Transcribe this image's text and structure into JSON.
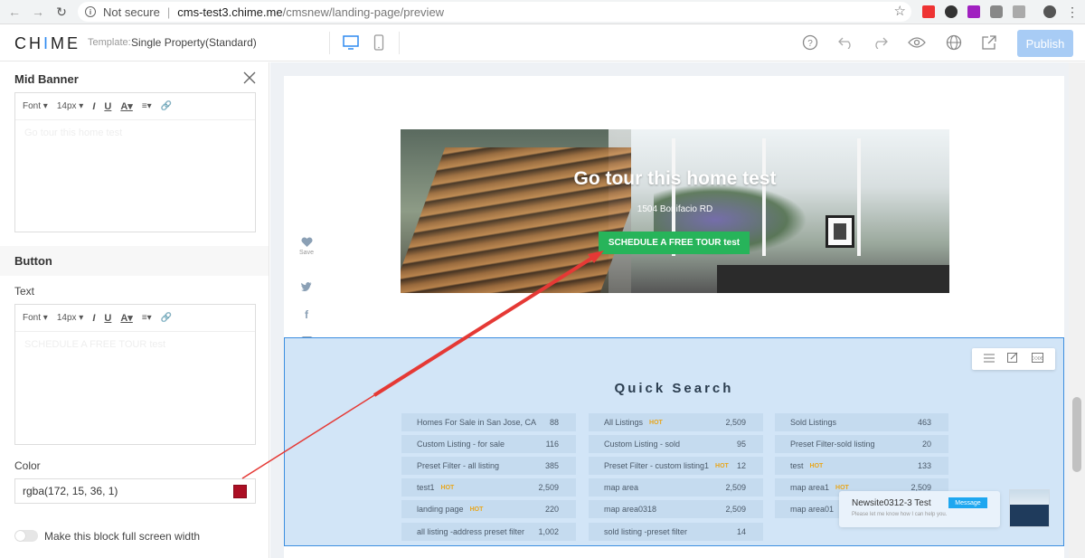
{
  "browser": {
    "not_secure": "Not secure",
    "host": "cms-test3.chime.me",
    "path": "/cmsnew/landing-page/preview"
  },
  "app": {
    "logo_prefix": "CH",
    "logo_i": "I",
    "logo_suffix": "ME",
    "template_label": "Template:",
    "template_name": "Single Property(Standard)",
    "publish_label": "Publish"
  },
  "panel": {
    "title": "Mid Banner",
    "editor1": {
      "font": "Font",
      "size": "14px",
      "placeholder": "Go tour this home test"
    },
    "button_section": "Button",
    "text_label": "Text",
    "editor2": {
      "font": "Font",
      "size": "14px",
      "placeholder": "SCHEDULE A FREE TOUR test"
    },
    "color_label": "Color",
    "color_value": "rgba(172, 15, 36, 1)",
    "color_hex": "#ac0f24",
    "fullscreen_label": "Make this block full screen width"
  },
  "banner": {
    "title": "Go tour this home test",
    "subtitle": "1504 Bonifacio RD",
    "cta": "SCHEDULE A FREE TOUR test"
  },
  "share": {
    "save_label": "Save"
  },
  "quick_search": {
    "title": "Quick Search",
    "hot_label": "HOT",
    "columns": [
      [
        {
          "name": "Homes For Sale in San Jose, CA",
          "count": "88",
          "hot": false
        },
        {
          "name": "Custom Listing - for sale",
          "count": "116",
          "hot": false
        },
        {
          "name": "Preset Filter - all listing",
          "count": "385",
          "hot": false
        },
        {
          "name": "test1",
          "count": "2,509",
          "hot": true
        },
        {
          "name": "landing page",
          "count": "220",
          "hot": true
        },
        {
          "name": "all listing -address preset filter",
          "count": "1,002",
          "hot": false
        }
      ],
      [
        {
          "name": "All Listings",
          "count": "2,509",
          "hot": true
        },
        {
          "name": "Custom Listing - sold",
          "count": "95",
          "hot": false
        },
        {
          "name": "Preset Filter - custom listing1",
          "count": "12",
          "hot": true
        },
        {
          "name": "map area",
          "count": "2,509",
          "hot": false
        },
        {
          "name": "map area0318",
          "count": "2,509",
          "hot": false
        },
        {
          "name": "sold listing -preset filter",
          "count": "14",
          "hot": false
        }
      ],
      [
        {
          "name": "Sold Listings",
          "count": "463",
          "hot": false
        },
        {
          "name": "Preset Filter-sold listing",
          "count": "20",
          "hot": false
        },
        {
          "name": "test",
          "count": "133",
          "hot": true
        },
        {
          "name": "map area1",
          "count": "2,509",
          "hot": true
        },
        {
          "name": "map area01",
          "count": "",
          "hot": false
        }
      ]
    ]
  },
  "chat": {
    "title": "Newsite0312-3 Test",
    "message_button": "Message",
    "subtitle": "Please let me know how I can help you."
  }
}
